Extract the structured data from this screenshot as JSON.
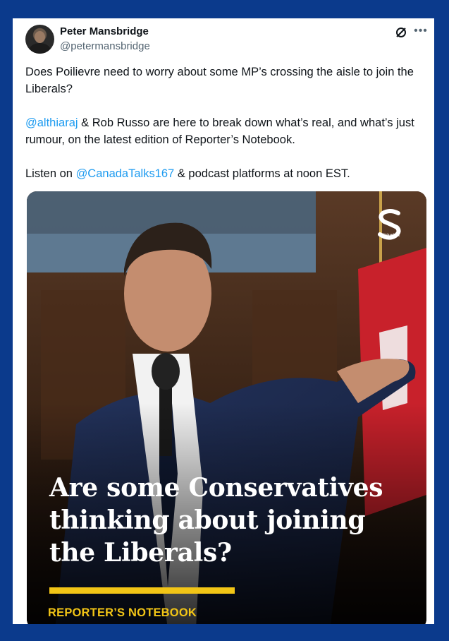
{
  "author": {
    "name": "Peter Mansbridge",
    "handle": "@petermansbridge"
  },
  "tweet": {
    "para1": "Does Poilievre need to worry about some MP’s crossing the aisle to join the Liberals?",
    "para2_mention": "@althiaraj",
    "para2_rest": " & Rob Russo are here to break down what’s real, and what’s just rumour, on the latest edition of Reporter’s Notebook.",
    "para3_prefix": "Listen on ",
    "para3_mention": "@CanadaTalks167",
    "para3_suffix": " & podcast platforms at noon EST."
  },
  "media": {
    "headline_line1": "Are some Conservatives",
    "headline_line2": "thinking about joining",
    "headline_line3": "the Liberals?",
    "footer_label": "REPORTER’S NOTEBOOK",
    "logo_text": "SiriusXM"
  },
  "icons": {
    "grok": "grok-icon",
    "more": "more-icon",
    "logo": "siriusxm-logo-icon"
  },
  "colors": {
    "background": "#0b3a8c",
    "mention": "#1d9bf0",
    "accent": "#f2c516",
    "text": "#0f1419",
    "secondary": "#536471"
  }
}
